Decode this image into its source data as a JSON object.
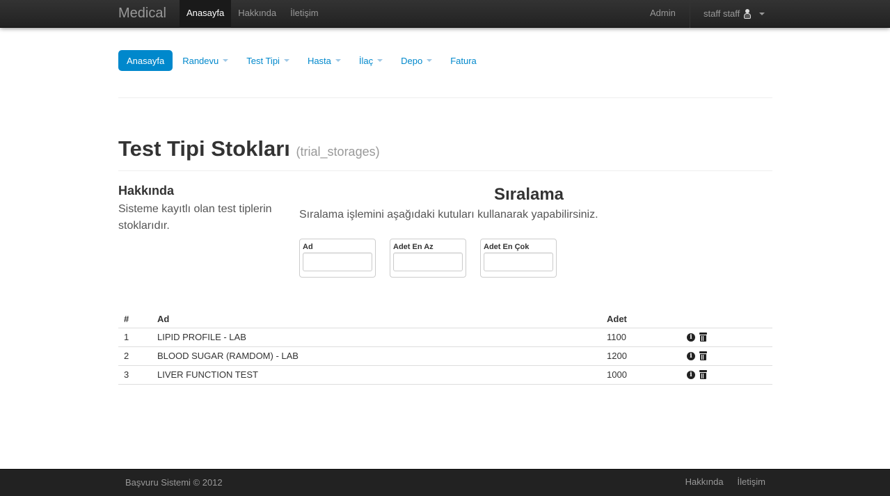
{
  "navbar": {
    "brand": "Medical",
    "items": [
      {
        "label": "Anasayfa",
        "active": true
      },
      {
        "label": "Hakkında",
        "active": false
      },
      {
        "label": "İletişim",
        "active": false
      }
    ],
    "admin": "Admin",
    "user": "staff staff"
  },
  "pills": [
    {
      "label": "Anasayfa",
      "active": true,
      "dropdown": false
    },
    {
      "label": "Randevu",
      "active": false,
      "dropdown": true
    },
    {
      "label": "Test Tipi",
      "active": false,
      "dropdown": true
    },
    {
      "label": "Hasta",
      "active": false,
      "dropdown": true
    },
    {
      "label": "İlaç",
      "active": false,
      "dropdown": true
    },
    {
      "label": "Depo",
      "active": false,
      "dropdown": true
    },
    {
      "label": "Fatura",
      "active": false,
      "dropdown": false
    }
  ],
  "header": {
    "title": "Test Tipi Stokları",
    "subtitle": "(trial_storages)"
  },
  "about": {
    "title": "Hakkında",
    "text": "Sisteme kayıtlı olan test tiplerin stoklarıdır."
  },
  "sorting": {
    "title": "Sıralama",
    "description": "Sıralama işlemini aşağıdaki kutuları kullanarak yapabilirsiniz.",
    "filters": [
      {
        "label": "Ad",
        "value": ""
      },
      {
        "label": "Adet En Az",
        "value": ""
      },
      {
        "label": "Adet En Çok",
        "value": ""
      }
    ]
  },
  "table": {
    "headers": {
      "num": "#",
      "name": "Ad",
      "count": "Adet"
    },
    "rows": [
      {
        "num": "1",
        "name": "LIPID PROFILE - LAB",
        "count": "1100"
      },
      {
        "num": "2",
        "name": "BLOOD SUGAR (RAMDOM) - LAB",
        "count": "1200"
      },
      {
        "num": "3",
        "name": "LIVER FUNCTION TEST",
        "count": "1000"
      }
    ]
  },
  "footer": {
    "copyright": "Başvuru Sistemi © 2012",
    "links": [
      "Hakkında",
      "İletişim"
    ]
  },
  "colors": {
    "navbar_bg": "#222222",
    "accent": "#0088cc",
    "footer_bg": "#222222"
  }
}
